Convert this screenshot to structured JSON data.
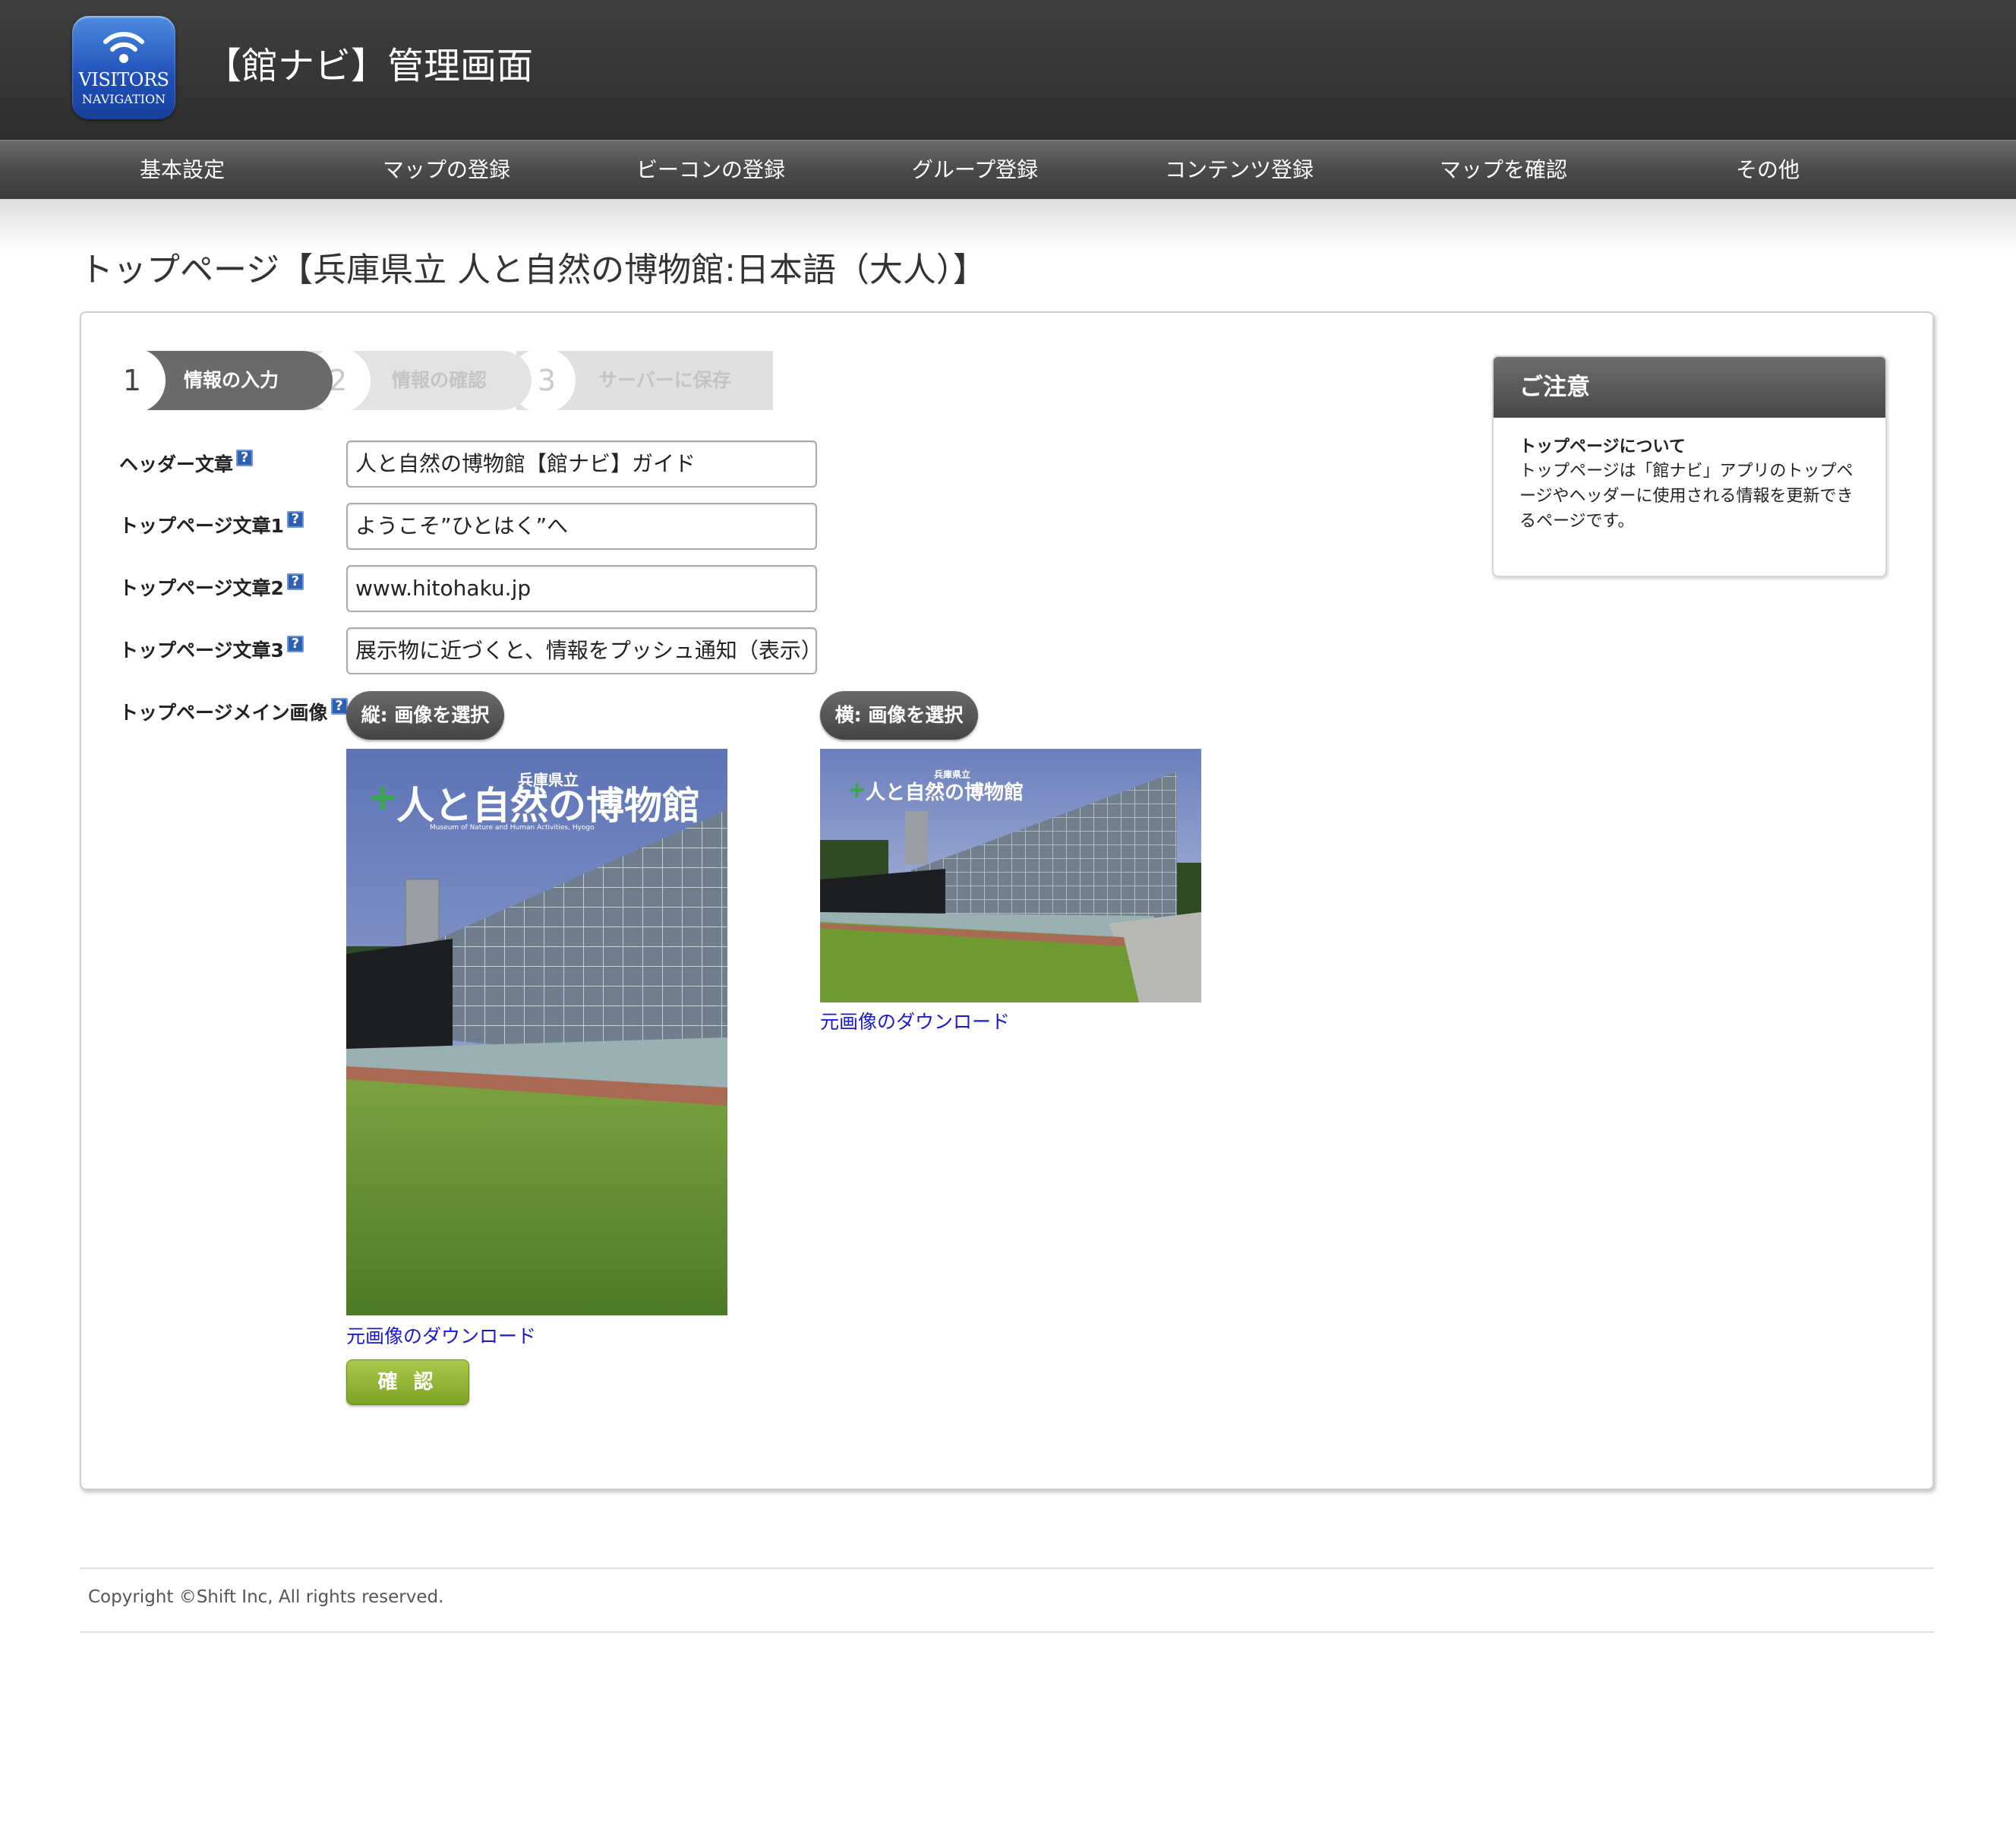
{
  "app": {
    "logo_line1": "VISITORS",
    "logo_line2": "NAVIGATION",
    "title": "【館ナビ】管理画面"
  },
  "nav": {
    "items": [
      "基本設定",
      "マップの登録",
      "ビーコンの登録",
      "グループ登録",
      "コンテンツ登録",
      "マップを確認",
      "その他"
    ]
  },
  "page": {
    "title": "トップページ【兵庫県立 人と自然の博物館:日本語（大人）】"
  },
  "steps": [
    {
      "num": "1",
      "label": "情報の入力",
      "active": true
    },
    {
      "num": "2",
      "label": "情報の確認",
      "active": false
    },
    {
      "num": "3",
      "label": "サーバーに保存",
      "active": false
    }
  ],
  "form": {
    "header_text": {
      "label": "ヘッダー文章",
      "value": "人と自然の博物館【館ナビ】ガイド"
    },
    "top_text1": {
      "label": "トップページ文章1",
      "value": "ようこそ”ひとはく”へ"
    },
    "top_text2": {
      "label": "トップページ文章2",
      "value": "www.hitohaku.jp"
    },
    "top_text3": {
      "label": "トップページ文章3",
      "value": "展示物に近づくと、情報をプッシュ通知（表示）し"
    },
    "main_image": {
      "label": "トップページメイン画像",
      "portrait_button": "縦: 画像を選択",
      "landscape_button": "横: 画像を選択",
      "download_link": "元画像のダウンロード",
      "museum_logo_text": "人と自然の博物館",
      "museum_logo_prefix": "兵庫県立",
      "museum_logo_en": "Museum of Nature and Human Activities, Hyogo"
    },
    "help_glyph": "?",
    "confirm_button": "確 認"
  },
  "notice": {
    "title": "ご注意",
    "subtitle": "トップページについて",
    "body": "トップページは「館ナビ」アプリのトップページやヘッダーに使用される情報を更新できるページです。"
  },
  "footer": {
    "copyright": "Copyright ©Shift Inc, All rights reserved."
  },
  "colors": {
    "header_bg": "#333333",
    "link": "#1a1acc",
    "confirm": "#8fb12d",
    "help_icon": "#2e5fb0"
  }
}
